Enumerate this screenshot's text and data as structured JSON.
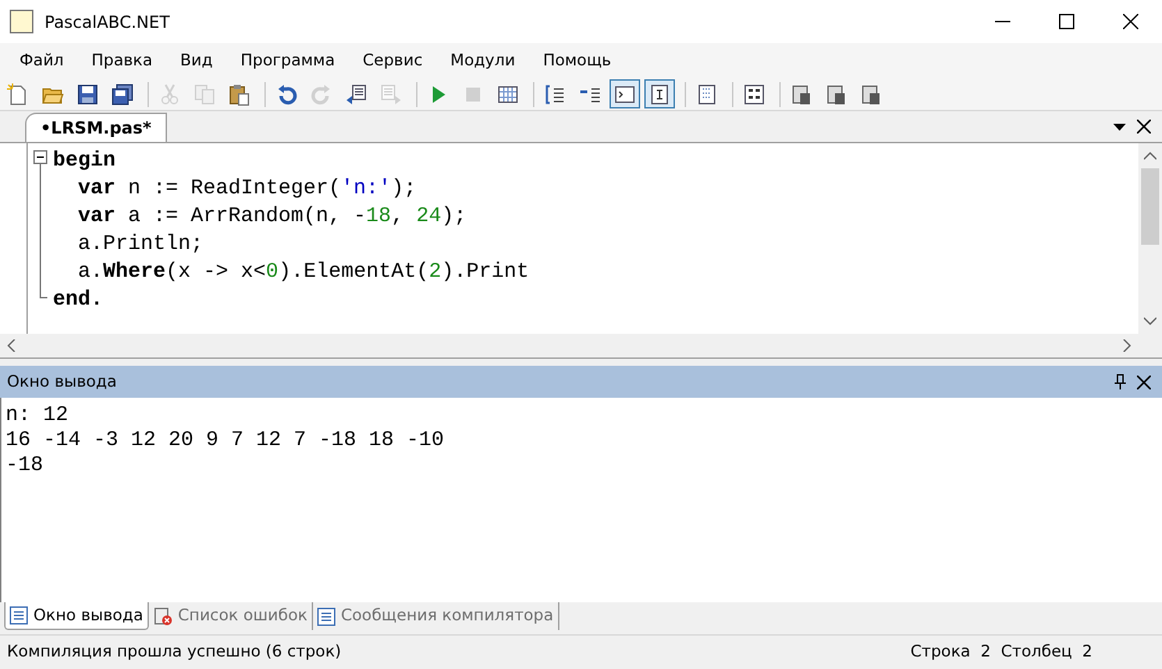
{
  "window": {
    "title": "PascalABC.NET"
  },
  "menu": [
    "Файл",
    "Правка",
    "Вид",
    "Программа",
    "Сервис",
    "Модули",
    "Помощь"
  ],
  "toolbar": [
    [
      {
        "kind": "new",
        "disabled": false,
        "selected": false
      },
      {
        "kind": "open",
        "disabled": false,
        "selected": false
      },
      {
        "kind": "save",
        "disabled": false,
        "selected": false
      },
      {
        "kind": "save-all",
        "disabled": false,
        "selected": false
      }
    ],
    [
      {
        "kind": "cut",
        "disabled": true,
        "selected": false
      },
      {
        "kind": "copy",
        "disabled": true,
        "selected": false
      },
      {
        "kind": "paste",
        "disabled": false,
        "selected": false
      }
    ],
    [
      {
        "kind": "undo",
        "disabled": false,
        "selected": false
      },
      {
        "kind": "redo",
        "disabled": true,
        "selected": false
      },
      {
        "kind": "unindent",
        "disabled": false,
        "selected": false
      },
      {
        "kind": "indent",
        "disabled": true,
        "selected": false
      }
    ],
    [
      {
        "kind": "run",
        "disabled": false,
        "selected": false
      },
      {
        "kind": "stop",
        "disabled": true,
        "selected": false
      },
      {
        "kind": "compile",
        "disabled": false,
        "selected": false
      }
    ],
    [
      {
        "kind": "comment",
        "disabled": false,
        "selected": false
      },
      {
        "kind": "format",
        "disabled": false,
        "selected": false
      },
      {
        "kind": "console",
        "disabled": false,
        "selected": true
      },
      {
        "kind": "text-window",
        "disabled": false,
        "selected": true
      }
    ],
    [
      {
        "kind": "outline",
        "disabled": false,
        "selected": false
      }
    ],
    [
      {
        "kind": "code",
        "disabled": false,
        "selected": false
      }
    ],
    [
      {
        "kind": "doc",
        "disabled": false,
        "selected": false
      },
      {
        "kind": "doc",
        "disabled": false,
        "selected": false
      },
      {
        "kind": "doc",
        "disabled": false,
        "selected": false
      }
    ]
  ],
  "file_tab": {
    "label": "•LRSM.pas*",
    "selected": true
  },
  "editor": {
    "lines": [
      {
        "tokens": [
          {
            "text": "begin",
            "kind": "keyword"
          }
        ],
        "children": [
          {
            "tokens": [
              {
                "text": "var",
                "kind": "keyword"
              },
              {
                "text": " n := ReadInteger(",
                "kind": "plain"
              },
              {
                "text": "'n:'",
                "kind": "string"
              },
              {
                "text": ");",
                "kind": "plain"
              }
            ]
          },
          {
            "tokens": [
              {
                "text": "var",
                "kind": "keyword"
              },
              {
                "text": " a := ArrRandom(n, -",
                "kind": "plain"
              },
              {
                "text": "18",
                "kind": "number"
              },
              {
                "text": ", ",
                "kind": "plain"
              },
              {
                "text": "24",
                "kind": "number"
              },
              {
                "text": ");",
                "kind": "plain"
              }
            ]
          },
          {
            "tokens": [
              {
                "text": "a.Println;",
                "kind": "plain"
              }
            ]
          },
          {
            "tokens": [
              {
                "text": "a.",
                "kind": "plain"
              },
              {
                "text": "Where",
                "kind": "keyword"
              },
              {
                "text": "(x -> x<",
                "kind": "plain"
              },
              {
                "text": "0",
                "kind": "number"
              },
              {
                "text": ").ElementAt(",
                "kind": "plain"
              },
              {
                "text": "2",
                "kind": "number"
              },
              {
                "text": ").Print",
                "kind": "plain"
              }
            ]
          }
        ]
      },
      {
        "tokens": [
          {
            "text": "end.",
            "kind": "keyword"
          }
        ]
      }
    ]
  },
  "output_panel": {
    "title": "Окно вывода",
    "lines": [
      "n: 12",
      "16 -14 -3 12 20 9 7 12 7 -18 18 -10",
      "-18"
    ]
  },
  "bottom_tabs": [
    {
      "label": "Окно вывода",
      "kind": "output",
      "selected": true
    },
    {
      "label": "Список ошибок",
      "kind": "errors",
      "selected": false
    },
    {
      "label": "Сообщения компилятора",
      "kind": "messages",
      "selected": false
    }
  ],
  "status_bar": {
    "message": "Компиляция прошла успешно (6 строк)",
    "position": "Строка  2  Столбец  2"
  }
}
